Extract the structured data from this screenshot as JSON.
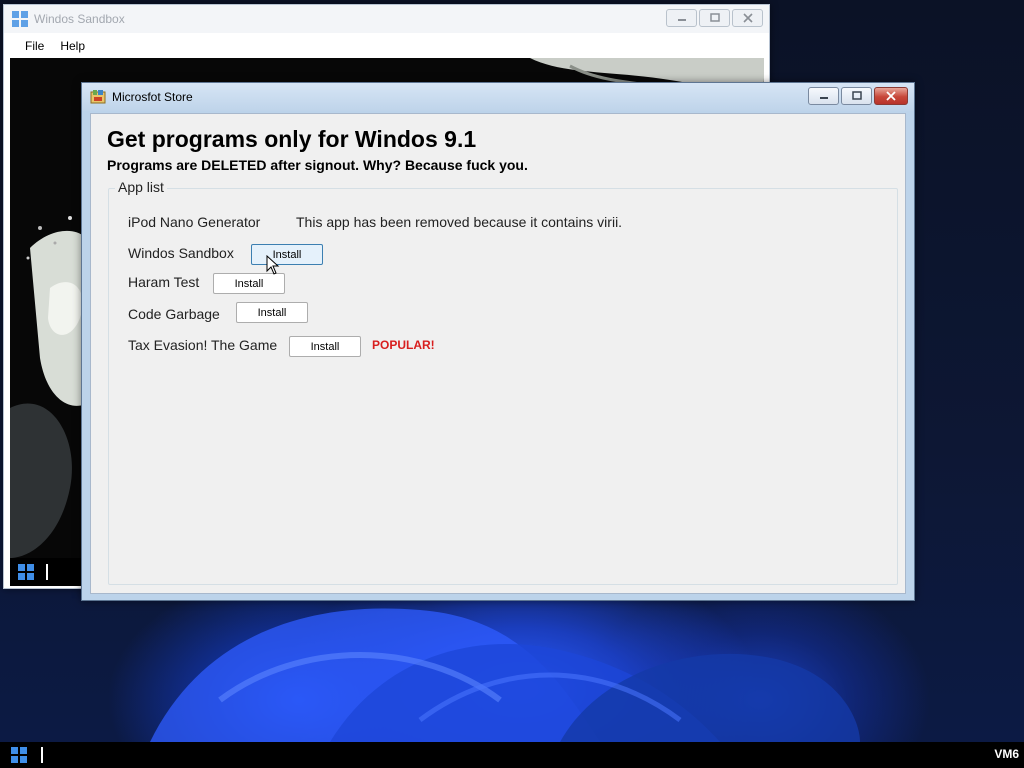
{
  "desktop": {
    "taskbar": {
      "start_icon": "windows-logo-icon",
      "vm_label": "VM6"
    }
  },
  "sandbox_window": {
    "title": "Windos Sandbox",
    "menu": [
      "File",
      "Help"
    ],
    "start_icon": "windows-logo-icon"
  },
  "store_window": {
    "title": "Microsfot Store",
    "heading": "Get programs only for Windos 9.1",
    "subheading": "Programs are DELETED after signout. Why? Because fuck you.",
    "group_label": "App list",
    "apps": [
      {
        "name": "iPod Nano Generator",
        "note": "This app has been removed because it contains virii."
      },
      {
        "name": "Windos Sandbox",
        "button": "Install"
      },
      {
        "name": "Haram Test",
        "button": "Install"
      },
      {
        "name": "Code Garbage",
        "button": "Install"
      },
      {
        "name": "Tax Evasion! The Game",
        "button": "Install",
        "badge": "POPULAR!"
      }
    ],
    "hovered_app": "Windos Sandbox"
  },
  "colors": {
    "popular_badge": "#d81e1e",
    "title_bar": "#bfd4ea",
    "taskbar": "#000000"
  }
}
